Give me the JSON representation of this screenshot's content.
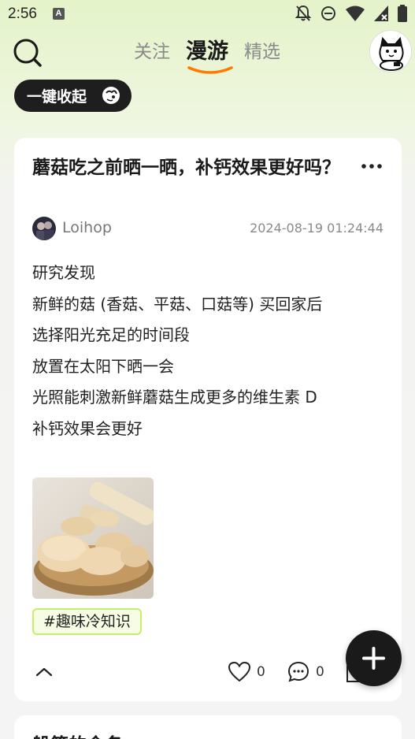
{
  "status_bar": {
    "time": "2:56",
    "notification_icon": "A",
    "icons": [
      "bell-off-icon",
      "dnd-icon",
      "wifi-icon",
      "cell-signal-icon",
      "battery-icon"
    ]
  },
  "nav": {
    "tabs": [
      {
        "label": "关注",
        "active": false
      },
      {
        "label": "漫游",
        "active": true
      },
      {
        "label": "精选",
        "active": false
      }
    ],
    "accent_color": "#ff7a00"
  },
  "collapse_button": {
    "label": "一键收起"
  },
  "post": {
    "title": "蘑菇吃之前晒一晒，补钙效果更好吗？",
    "author": "Loihop",
    "time": "2024-08-19 01:24:44",
    "body_lines": [
      "研究发现",
      "新鲜的菇 (香菇、平菇、口菇等) 买回家后",
      "选择阳光充足的时间段",
      "放置在太阳下晒一会",
      "光照能刺激新鲜蘑菇生成更多的维生素 D",
      "补钙效果会更好"
    ],
    "tag": "#趣味冷知识",
    "like_count": "0",
    "comment_count": "0"
  },
  "next_post": {
    "title": "躲箭的命名"
  },
  "colors": {
    "tag_border": "#c6ee6a",
    "tag_bg": "#f6fde4",
    "fab_bg": "#1a1a1a"
  }
}
